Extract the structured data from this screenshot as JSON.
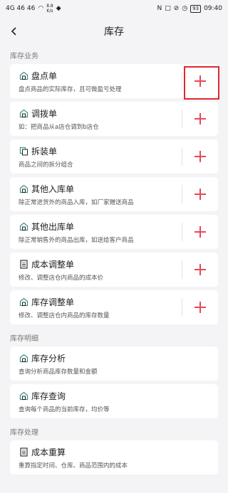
{
  "status": {
    "carrier_left": "4G 46 46",
    "speed_value": "8.8",
    "speed_unit": "K/s",
    "battery": "93",
    "time": "09:40"
  },
  "header": {
    "title": "库存",
    "back_icon": "chevron-left-icon"
  },
  "sections": [
    {
      "title": "库存业务",
      "items": [
        {
          "title": "盘点单",
          "desc": "盘点商品的实际库存，且可做盈亏处理",
          "icon": "house-icon",
          "add": true
        },
        {
          "title": "调拨单",
          "desc": "如：把商品从a店仓调到b店仓",
          "icon": "house-icon",
          "add": true
        },
        {
          "title": "拆装单",
          "desc": "商品之间的拆分组合",
          "icon": "copy-icon",
          "add": true
        },
        {
          "title": "其他入库单",
          "desc": "除正常进货外的商品入库，如厂家赠送商品",
          "icon": "house-icon",
          "add": true
        },
        {
          "title": "其他出库单",
          "desc": "除正常销售外的商品出库，如送给客户商品",
          "icon": "house-icon",
          "add": true
        },
        {
          "title": "成本调整单",
          "desc": "修改、调整店仓内商品的成本价",
          "icon": "doc-icon",
          "add": true
        },
        {
          "title": "库存调整单",
          "desc": "修改、调整店仓内商品的库存数量",
          "icon": "house-icon",
          "add": true
        }
      ]
    },
    {
      "title": "库存明细",
      "items": [
        {
          "title": "库存分析",
          "desc": "查询分析商品库存数量和金额",
          "icon": "house-icon",
          "add": false
        },
        {
          "title": "库存查询",
          "desc": "查询每个商品的当前库存，均价等",
          "icon": "house-icon",
          "add": false
        }
      ]
    },
    {
      "title": "库存处理",
      "items": [
        {
          "title": "成本重算",
          "desc": "重算指定时间、仓库、商品范围内的成本",
          "icon": "doc-icon",
          "add": false
        }
      ]
    }
  ],
  "colors": {
    "accent": "#e84855",
    "highlight": "#e0282e",
    "background": "#f4f4f6"
  }
}
